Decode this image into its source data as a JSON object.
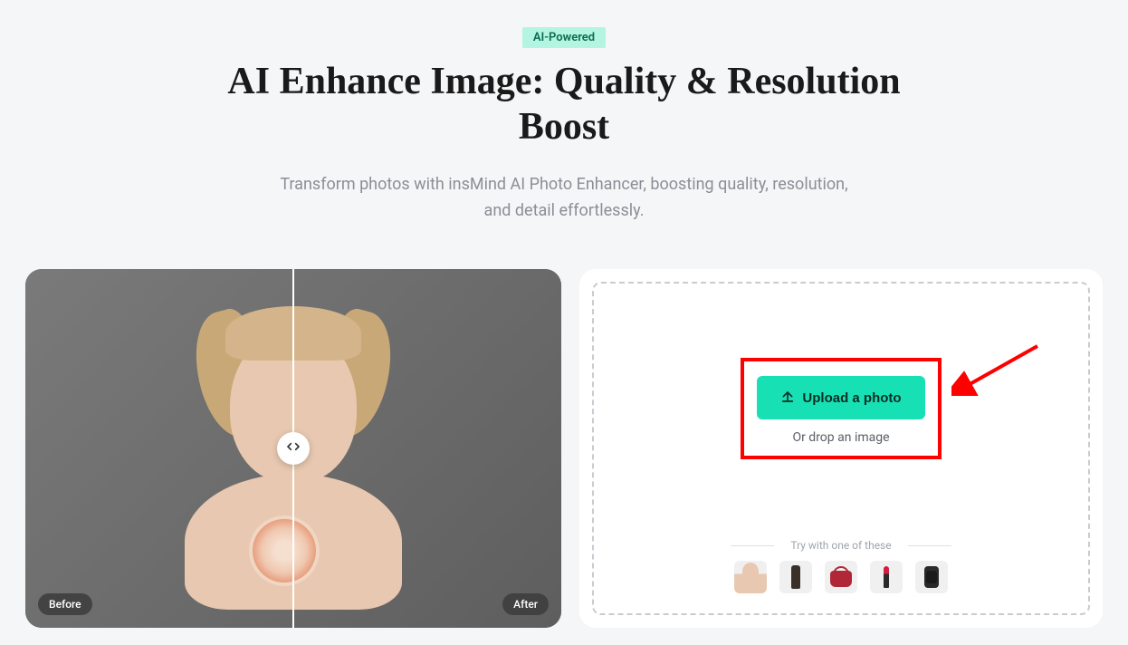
{
  "badge": "AI-Powered",
  "title": "AI Enhance Image: Quality & Resolution Boost",
  "subtitle": "Transform photos with insMind AI Photo Enhancer, boosting quality, resolution, and detail effortlessly.",
  "preview": {
    "before_label": "Before",
    "after_label": "After"
  },
  "upload": {
    "button_label": "Upload a photo",
    "drop_text": "Or drop an image",
    "samples_label": "Try with one of these",
    "samples": [
      {
        "name": "portrait"
      },
      {
        "name": "bottle"
      },
      {
        "name": "handbag"
      },
      {
        "name": "lipstick"
      },
      {
        "name": "watch"
      }
    ]
  }
}
